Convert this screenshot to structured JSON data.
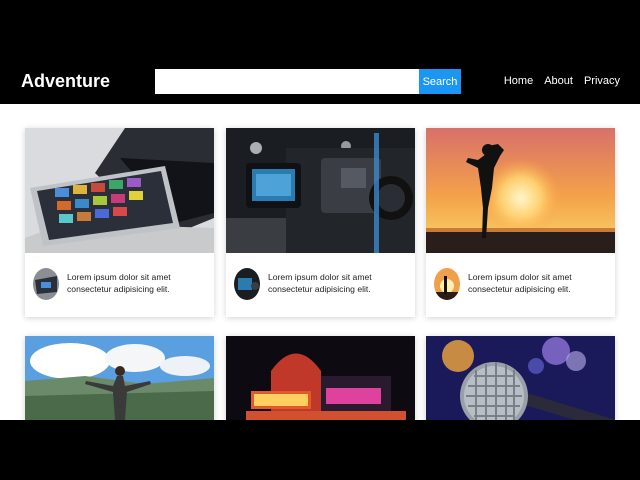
{
  "brand": "Adventure",
  "search": {
    "placeholder": "",
    "button_label": "Search"
  },
  "nav": {
    "items": [
      "Home",
      "About",
      "Privacy"
    ]
  },
  "cards": [
    {
      "text": "Lorem ipsum dolor sit amet consectetur adipisicing elit.",
      "image": "tablet-laptop"
    },
    {
      "text": "Lorem ipsum dolor sit amet consectetur adipisicing elit.",
      "image": "video-camera"
    },
    {
      "text": "Lorem ipsum dolor sit amet consectetur adipisicing elit.",
      "image": "sunset-silhouette"
    },
    {
      "text": "",
      "image": "mountain-hiker"
    },
    {
      "text": "",
      "image": "cinema-street"
    },
    {
      "text": "",
      "image": "microphone"
    }
  ],
  "colors": {
    "accent": "#1b96f3",
    "header": "#000000",
    "page": "#ffffff"
  }
}
